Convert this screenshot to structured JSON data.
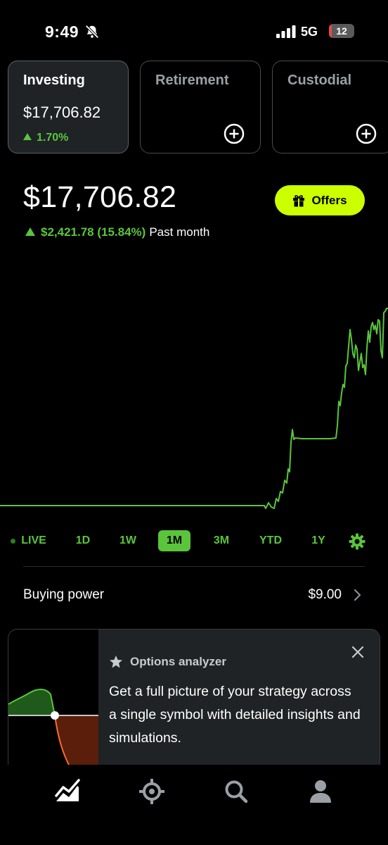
{
  "status_bar": {
    "time": "9:49",
    "network": "5G",
    "battery_level": "12",
    "battery_fraction": 0.12
  },
  "accounts": [
    {
      "name": "Investing",
      "value": "$17,706.82",
      "change": "1.70%",
      "active": true
    },
    {
      "name": "Retirement",
      "active": false,
      "icon": "plus-circle-icon"
    },
    {
      "name": "Custodial",
      "active": false,
      "icon": "plus-circle-icon"
    }
  ],
  "portfolio": {
    "value": "$17,706.82",
    "change": "$2,421.78 (15.84%)",
    "period": "Past month"
  },
  "offers_button": {
    "label": "Offers",
    "icon": "gift-icon"
  },
  "colors": {
    "accent_green": "#5ac53b",
    "offers_yellow": "#ccff00",
    "background": "#000000",
    "card_background": "#1f2326"
  },
  "range_tabs": [
    {
      "label": "LIVE",
      "active": false
    },
    {
      "label": "1D",
      "active": false
    },
    {
      "label": "1W",
      "active": false
    },
    {
      "label": "1M",
      "active": true
    },
    {
      "label": "3M",
      "active": false
    },
    {
      "label": "YTD",
      "active": false
    },
    {
      "label": "1Y",
      "active": false
    }
  ],
  "buying_power": {
    "label": "Buying power",
    "value": "$9.00"
  },
  "options_card": {
    "title": "Options analyzer",
    "body": "Get a full picture of your strategy across a single symbol with detailed insights and simulations."
  },
  "bottom_nav": [
    {
      "icon": "chart-icon",
      "active": true
    },
    {
      "icon": "crypto-icon",
      "active": false
    },
    {
      "icon": "search-icon",
      "active": false
    },
    {
      "icon": "profile-icon",
      "active": false
    }
  ]
}
